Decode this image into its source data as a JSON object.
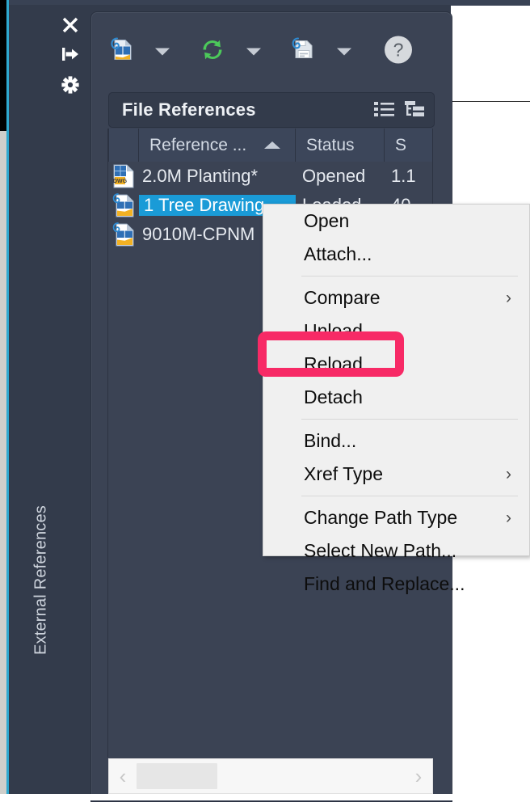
{
  "window": {
    "dock_tab_label": "External References",
    "dock_buttons": [
      {
        "name": "close-icon",
        "label": "Close"
      },
      {
        "name": "auto-hide-icon",
        "label": "Auto-hide"
      },
      {
        "name": "settings-gear-icon",
        "label": "Properties"
      }
    ]
  },
  "toolbar": {
    "items": [
      {
        "name": "attach-dwg-icon",
        "label": "Attach DWG"
      },
      {
        "name": "attach-dropdown-caret",
        "label": "Attach options"
      },
      {
        "name": "refresh-icon",
        "label": "Refresh"
      },
      {
        "name": "refresh-dropdown-caret",
        "label": "Refresh options"
      },
      {
        "name": "changes-to-xref-icon",
        "label": "Changes to xrefs"
      },
      {
        "name": "changes-dropdown-caret",
        "label": "Change options"
      },
      {
        "name": "help-icon",
        "label": "Help"
      }
    ]
  },
  "file_references": {
    "title": "File References",
    "view_buttons": [
      {
        "name": "list-view-icon",
        "label": "List View"
      },
      {
        "name": "tree-view-icon",
        "label": "Tree View"
      }
    ],
    "columns": [
      {
        "key": "icon",
        "label": ""
      },
      {
        "key": "reference",
        "label": "Reference ...",
        "sort": "asc"
      },
      {
        "key": "status",
        "label": "Status"
      },
      {
        "key": "size",
        "label": "S"
      }
    ],
    "rows": [
      {
        "icon": "dwg-file-icon",
        "reference": "2.0M Planting*",
        "status": "Opened",
        "size": "1.1",
        "selected": false
      },
      {
        "icon": "xref-file-icon",
        "reference": "1 Tree Drawing",
        "status": "Loaded",
        "size": "40",
        "selected": true
      },
      {
        "icon": "xref-file-icon",
        "reference": "9010M-CPNM",
        "status": "",
        "size": "",
        "selected": false
      }
    ]
  },
  "context_menu": {
    "items": [
      {
        "label": "Open",
        "submenu": false,
        "separator_after": false
      },
      {
        "label": "Attach...",
        "submenu": false,
        "separator_after": true
      },
      {
        "label": "Compare",
        "submenu": true,
        "separator_after": false
      },
      {
        "label": "Unload",
        "submenu": false,
        "separator_after": false
      },
      {
        "label": "Reload",
        "submenu": false,
        "separator_after": false,
        "highlighted": true
      },
      {
        "label": "Detach",
        "submenu": false,
        "separator_after": true
      },
      {
        "label": "Bind...",
        "submenu": false,
        "separator_after": false
      },
      {
        "label": "Xref Type",
        "submenu": true,
        "separator_after": true
      },
      {
        "label": "Change Path Type",
        "submenu": true,
        "separator_after": false
      },
      {
        "label": "Select New Path...",
        "submenu": false,
        "separator_after": false
      },
      {
        "label": "Find and Replace...",
        "submenu": false,
        "separator_after": false
      }
    ],
    "submenu_glyph": "›"
  },
  "scrollbar": {
    "left_arrow": "‹",
    "right_arrow": "›"
  },
  "colors": {
    "panel_bg": "#3b4354",
    "dock_bg": "#333b4b",
    "selection_blue": "#1a9bd7",
    "highlight_pink": "#f72a66",
    "menu_bg": "#f0f0f0",
    "accent_cyan": "#2fa8cf"
  }
}
